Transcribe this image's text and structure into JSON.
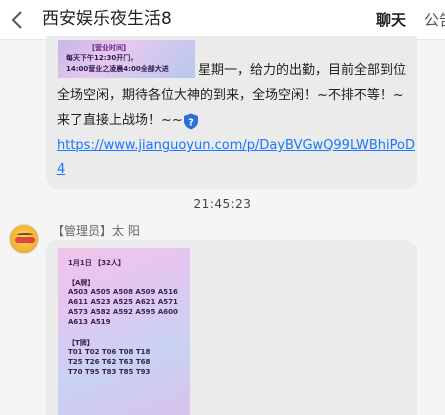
{
  "header": {
    "title": "西安娱乐夜生活8",
    "tab_chat": "聊天",
    "tab_notice": "公告"
  },
  "message1": {
    "poster": {
      "title": "【营业时间】",
      "line1": "每天下午12:30开门，",
      "line2": "14:00营业之凌晨4:00全部大进"
    },
    "text_line1": "星期一，给力的出勤，目前全部到位",
    "text_line2": "全场空闲，期待各位大神的到来，全场空闲！~不排不等！~",
    "text_line3": "来了直接上战场！~~",
    "link_line1": "https://www.jianguoyun.com/p/DayBVGwQ99LWBhiPoD",
    "link_line2": "4"
  },
  "timestamp": "21:45:23",
  "message2": {
    "sender": "【管理员】太 阳",
    "poster": {
      "date": "1月1日 【32人】",
      "section_a": "【A牌】",
      "a_rows": [
        "A503 A505 A508 A509 A516",
        "A611 A523 A525 A621 A571",
        "A573 A582 A592 A595 A600",
        "A613 A519"
      ],
      "section_t": "【T牌】",
      "t_rows": [
        "T01 T02 T06 T08 T18",
        "T25 T26 T62 T63 T68",
        "T70 T95 T83 T85 T93"
      ]
    }
  },
  "colors": {
    "link": "#1677ff",
    "accent_tab": "#1e90ff",
    "bubble": "#ebebeb",
    "background": "#f5f5f5"
  }
}
